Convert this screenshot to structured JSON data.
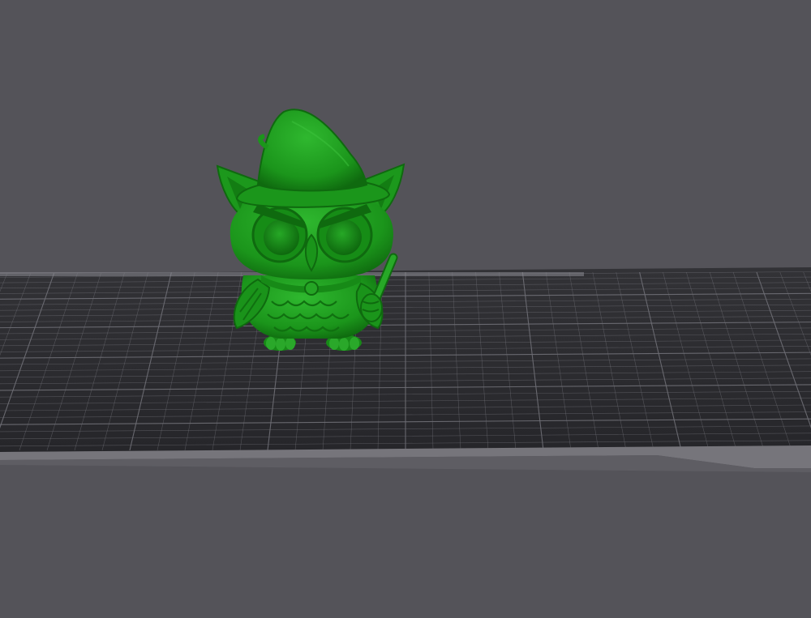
{
  "viewport": {
    "background_color": "#545359",
    "bed_surface_color": "#2b2b2f",
    "bed_grid_color": "#6f6f76",
    "bed_edge_color": "#75747a",
    "model_color": "#1f9a1f",
    "model_shadow_color": "#0f6a0f",
    "model_highlight_color": "#3fc23f"
  },
  "scene": {
    "model": {
      "name_icon": "owl-wizard-model",
      "selected": true
    },
    "build_plate": {
      "texture_icon": "build-plate-grid"
    }
  }
}
